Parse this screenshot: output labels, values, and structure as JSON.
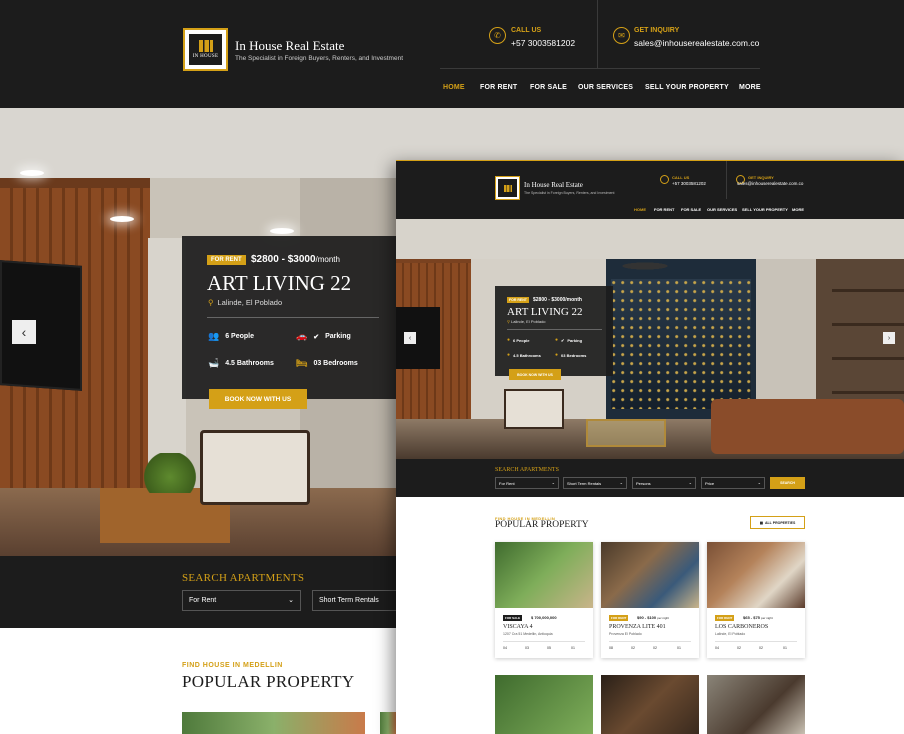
{
  "brand": {
    "name": "In House Real Estate",
    "tagline": "The Specialist in Foreign Buyers, Renters, and Investment",
    "logo_text": "IN HOUSE"
  },
  "contact": {
    "call_label": "CALL US",
    "call_value": "+57 3003581202",
    "inquiry_label": "GET INQUIRY",
    "inquiry_value": "sales@inhouserealestate.com.co"
  },
  "nav": [
    "HOME",
    "FOR RENT",
    "FOR SALE",
    "OUR SERVICES",
    "SELL YOUR PROPERTY",
    "MORE"
  ],
  "hero": {
    "badge": "FOR RENT",
    "price": "$2800 - $3000",
    "price_unit": "/month",
    "title": "ART LIVING 22",
    "location": "Lalinde, El Poblado",
    "features": {
      "people": "6 People",
      "parking": "Parking",
      "bathrooms": "4.5 Bathrooms",
      "bedrooms": "03 Bedrooms"
    },
    "book_label": "BOOK NOW WITH US"
  },
  "search": {
    "title": "SEARCH APARTMENTS",
    "fields": [
      "For Rent",
      "Short Term Rentals",
      "Persons",
      "Price"
    ],
    "button": "SEARCH"
  },
  "popular": {
    "eyebrow": "FIND HOUSE IN MEDELLIN",
    "title": "POPULAR PROPERTY",
    "all_label": "ALL PROPERTIES",
    "cards": [
      {
        "badge": "FOR SALE",
        "badge_color": "#1c1c1c",
        "price": "$ 700,000,000",
        "name": "VISCAYA 4",
        "location": "1207 Cra 51 Medellin, Antioquia",
        "stats": [
          "04",
          "03",
          "05",
          "01"
        ]
      },
      {
        "badge": "FOR RENT",
        "badge_color": "#d4a017",
        "price": "$90 - $100",
        "price_unit": "per night",
        "name": "PROVENZA LITE 401",
        "location": "Provenza El Poblado",
        "stats": [
          "08",
          "02",
          "02",
          "01"
        ]
      },
      {
        "badge": "FOR RENT",
        "badge_color": "#d4a017",
        "price": "$65 - $75",
        "price_unit": "per night",
        "name": "LOS CARBONEROS",
        "location": "Lalinde, El Poblado",
        "stats": [
          "04",
          "02",
          "02",
          "01"
        ]
      }
    ]
  },
  "colors": {
    "accent": "#d4a017",
    "dark": "#1c1c1c",
    "light": "#ffffff"
  },
  "icons": {
    "call": "phone-icon",
    "inquiry": "mail-icon",
    "location": "map-pin-icon",
    "people": "people-icon",
    "parking": "car-icon",
    "bath": "bath-icon",
    "bed": "bed-icon",
    "arrow_left": "chevron-left-icon",
    "arrow_right": "chevron-right-icon"
  }
}
